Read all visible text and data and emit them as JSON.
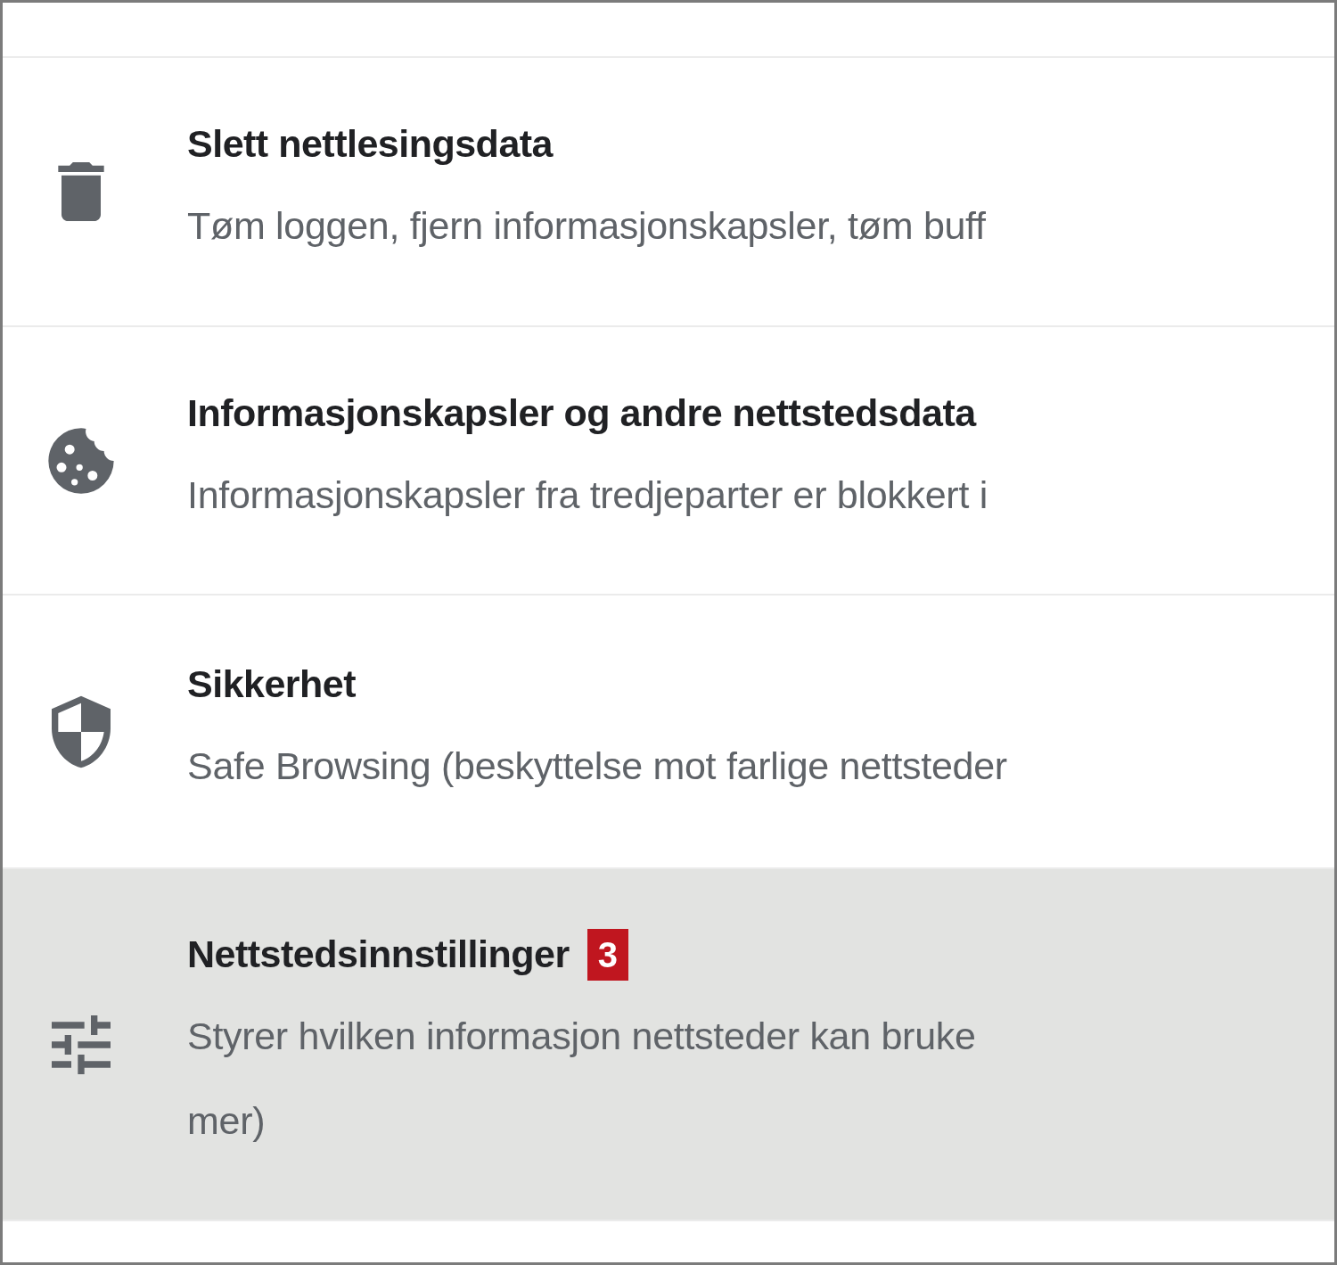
{
  "items": [
    {
      "title": "Slett nettlesingsdata",
      "description_lines": [
        "Tøm loggen, fjern informasjonskapsler, tøm buff"
      ],
      "selected": false
    },
    {
      "title": "Informasjonskapsler og andre nettstedsdata",
      "description_lines": [
        "Informasjonskapsler fra tredjeparter er blokkert i"
      ],
      "selected": false
    },
    {
      "title": "Sikkerhet",
      "description_lines": [
        "Safe Browsing (beskyttelse mot farlige nettsteder"
      ],
      "selected": false
    },
    {
      "title": "Nettstedsinnstillinger",
      "badge": "3",
      "description_lines": [
        "Styrer hvilken informasjon nettsteder kan bruke",
        "mer)"
      ],
      "selected": true
    }
  ]
}
